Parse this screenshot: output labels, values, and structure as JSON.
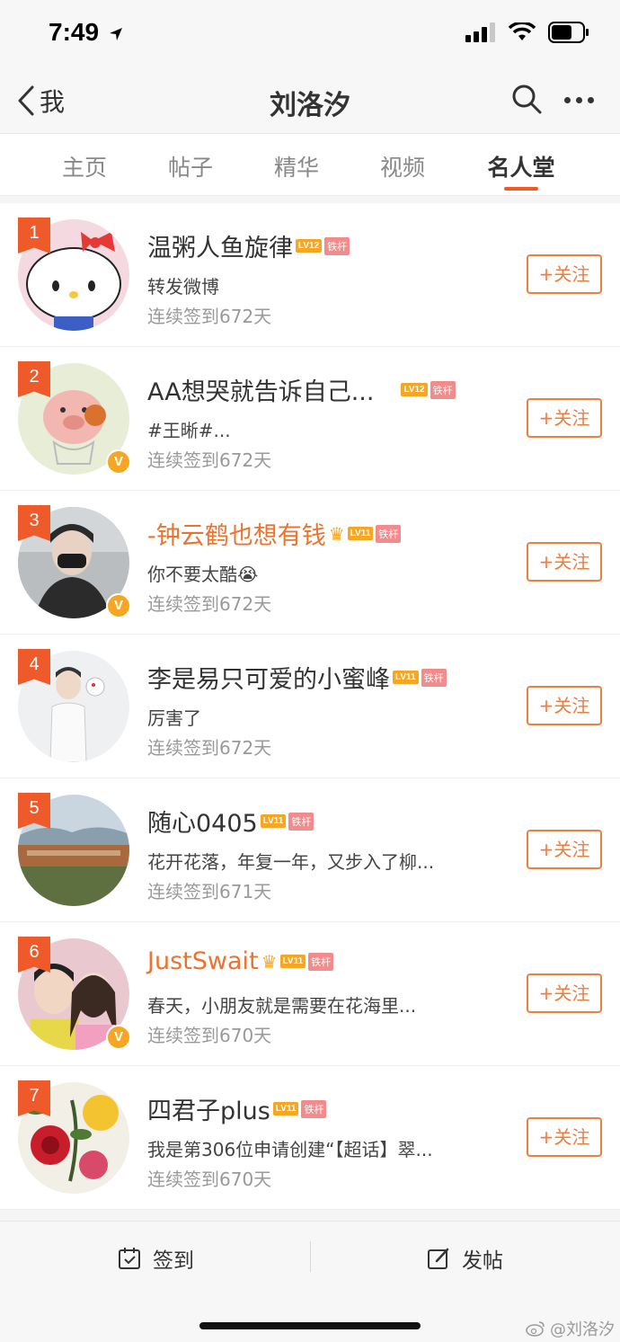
{
  "status_bar": {
    "time": "7:49"
  },
  "nav": {
    "back_label": "我",
    "title": "刘洛汐"
  },
  "tabs": [
    {
      "label": "主页"
    },
    {
      "label": "帖子"
    },
    {
      "label": "精华"
    },
    {
      "label": "视频"
    },
    {
      "label": "名人堂",
      "active": true
    }
  ],
  "members": [
    {
      "rank": "1",
      "name": "温粥人鱼旋律",
      "level": "LV12",
      "badge": "铁杆",
      "desc": "转发微博",
      "checkin": "连续签到672天",
      "follow": "+关注"
    },
    {
      "rank": "2",
      "name": "AA想哭就告诉自己...",
      "level": "LV12",
      "badge": "铁杆",
      "desc": "#王晰#...",
      "checkin": "连续签到672天",
      "follow": "+关注",
      "verified": "V"
    },
    {
      "rank": "3",
      "name": "-钟云鹤也想有钱",
      "level": "LV11",
      "badge": "铁杆",
      "desc": "你不要太酷😭",
      "checkin": "连续签到672天",
      "follow": "+关注",
      "verified": "V"
    },
    {
      "rank": "4",
      "name": "李是易只可爱的小蜜峰",
      "level": "LV11",
      "badge": "铁杆",
      "desc": "厉害了",
      "checkin": "连续签到672天",
      "follow": "+关注"
    },
    {
      "rank": "5",
      "name": "随心0405",
      "level": "LV11",
      "badge": "铁杆",
      "desc": "花开花落，年复一年，又步入了柳...",
      "checkin": "连续签到671天",
      "follow": "+关注"
    },
    {
      "rank": "6",
      "name": "JustSwait",
      "level": "LV11",
      "badge": "铁杆",
      "desc": "春天，小朋友就是需要在花海里...",
      "checkin": "连续签到670天",
      "follow": "+关注",
      "verified": "V"
    },
    {
      "rank": "7",
      "name": "四君子plus",
      "level": "LV11",
      "badge": "铁杆",
      "desc": "我是第306位申请创建“【超话】翠...",
      "checkin": "连续签到670天",
      "follow": "+关注"
    }
  ],
  "bottom_bar": {
    "checkin_label": "签到",
    "post_label": "发帖"
  },
  "watermark": "@刘洛汐",
  "colors": {
    "accent": "#f15a24",
    "follow": "#ef7d3c",
    "vip_name": "#eb7330",
    "level_badge": "#f5a623",
    "tie_badge": "#f28b8b"
  }
}
